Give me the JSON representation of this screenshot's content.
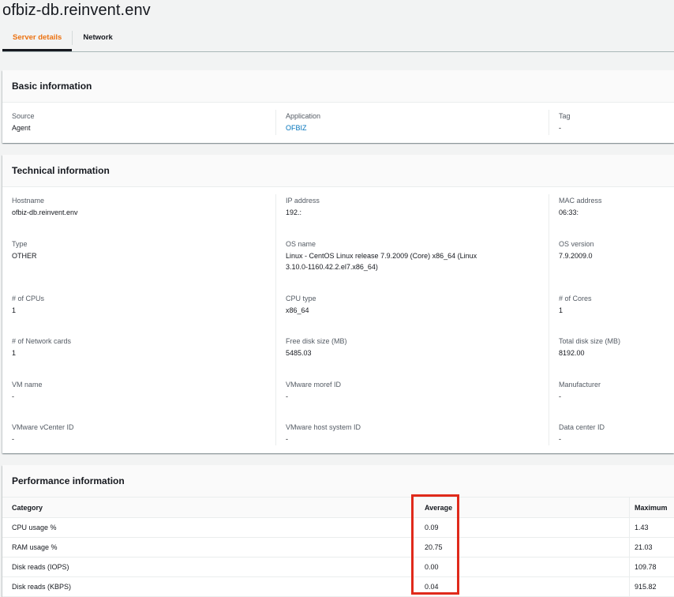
{
  "page": {
    "title": "ofbiz-db.reinvent.env"
  },
  "tabs": [
    {
      "label": "Server details",
      "active": true
    },
    {
      "label": "Network",
      "active": false
    }
  ],
  "basic": {
    "header": "Basic information",
    "fields": [
      {
        "label": "Source",
        "value": "Agent"
      },
      {
        "label": "Application",
        "value": "OFBIZ"
      },
      {
        "label": "Tag",
        "value": "-"
      }
    ]
  },
  "technical": {
    "header": "Technical information",
    "fields": [
      {
        "label": "Hostname",
        "value": "ofbiz-db.reinvent.env"
      },
      {
        "label": "IP address",
        "value": "192.:"
      },
      {
        "label": "MAC address",
        "value": "06:33:"
      },
      {
        "label": "Type",
        "value": "OTHER"
      },
      {
        "label": "OS name",
        "value": "Linux - CentOS Linux release 7.9.2009 (Core) x86_64 (Linux 3.10.0-1160.42.2.el7.x86_64)"
      },
      {
        "label": "OS version",
        "value": "7.9.2009.0"
      },
      {
        "label": "# of CPUs",
        "value": "1"
      },
      {
        "label": "CPU type",
        "value": "x86_64"
      },
      {
        "label": "# of Cores",
        "value": "1"
      },
      {
        "label": "# of Network cards",
        "value": "1"
      },
      {
        "label": "Free disk size (MB)",
        "value": "5485.03"
      },
      {
        "label": "Total disk size (MB)",
        "value": "8192.00"
      },
      {
        "label": "VM name",
        "value": "-"
      },
      {
        "label": "VMware moref ID",
        "value": "-"
      },
      {
        "label": "Manufacturer",
        "value": "-"
      },
      {
        "label": "VMware vCenter ID",
        "value": "-"
      },
      {
        "label": "VMware host system ID",
        "value": "-"
      },
      {
        "label": "Data center ID",
        "value": "-"
      }
    ]
  },
  "performance": {
    "header": "Performance information",
    "columns": [
      "Category",
      "Average",
      "Maximum"
    ],
    "rows": [
      {
        "category": "CPU usage %",
        "average": "0.09",
        "maximum": "1.43"
      },
      {
        "category": "RAM usage %",
        "average": "20.75",
        "maximum": "21.03"
      },
      {
        "category": "Disk reads (IOPS)",
        "average": "0.00",
        "maximum": "109.78"
      },
      {
        "category": "Disk reads (KBPS)",
        "average": "0.04",
        "maximum": "915.82"
      }
    ],
    "highlight_color": "#e02a1b"
  },
  "colors": {
    "accent": "#ec7211",
    "link": "#0073bb"
  }
}
